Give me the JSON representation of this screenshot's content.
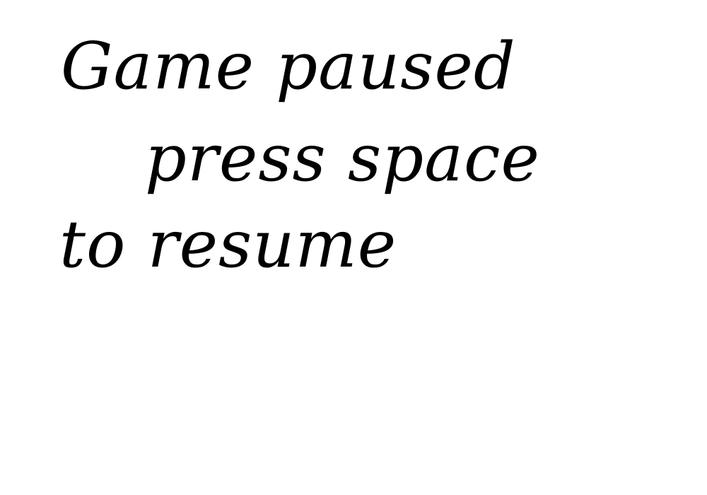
{
  "pause_screen": {
    "lines": [
      "Game paused",
      "press space",
      "to resume"
    ],
    "text_color": "#000000",
    "background_color": "#ffffff"
  }
}
